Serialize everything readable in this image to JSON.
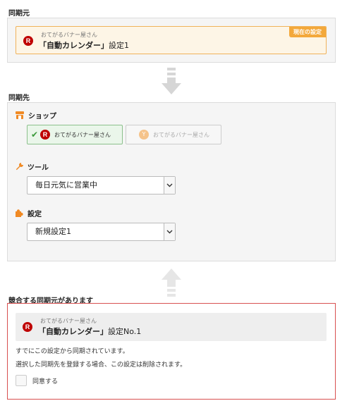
{
  "source": {
    "title": "同期元",
    "badge": "現在の設定",
    "shop_name": "おてがるバナー屋さん",
    "setting_bold": "「自動カレンダー」",
    "setting_plain": "設定1"
  },
  "destination": {
    "title": "同期先",
    "shop_label": "ショップ",
    "shops": [
      {
        "name": "おてがるバナー屋さん",
        "selected": true
      },
      {
        "name": "おてがるバナー屋さん",
        "selected": false
      }
    ],
    "tool_label": "ツール",
    "tool_value": "毎日元気に営業中",
    "setting_label": "設定",
    "setting_value": "新規設定1"
  },
  "conflict": {
    "title": "競合する同期元があります",
    "shop_name": "おてがるバナー屋さん",
    "setting_bold": "「自動カレンダー」",
    "setting_plain": "設定No.1",
    "message_line1": "すでにこの設定から同期されています。",
    "message_line2": "選択した同期先を登録する場合、この設定は削除されます。",
    "agree_label": "同意する"
  },
  "colors": {
    "accent_orange": "#f3a83b",
    "rakuten_red": "#bf0000",
    "conflict_red": "#d85050",
    "check_green": "#3a9a3a"
  }
}
